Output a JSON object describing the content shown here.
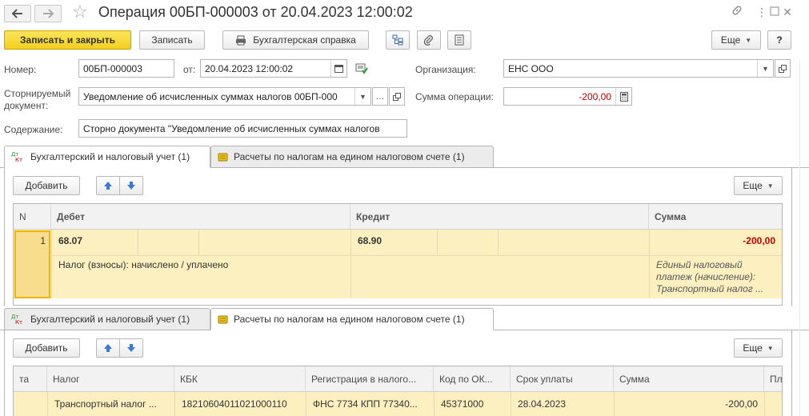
{
  "window": {
    "title": "Операция 00БП-000003 от 20.04.2023 12:00:02",
    "icons": [
      "back-arrow-icon",
      "forward-arrow-icon",
      "star-icon",
      "link-icon",
      "more-vertical-icon",
      "maximize-icon",
      "close-icon"
    ]
  },
  "toolbar": {
    "save_close": "Записать и закрыть",
    "save": "Записать",
    "report": "Бухгалтерская справка",
    "more": "Еще",
    "help": "?"
  },
  "form": {
    "number_label": "Номер:",
    "number_value": "00БП-000003",
    "date_label": "от:",
    "date_value": "20.04.2023 12:00:02",
    "org_label": "Организация:",
    "org_value": "ЕНС ООО",
    "reversed_label_1": "Сторнируемый",
    "reversed_label_2": "документ:",
    "reversed_value": "Уведомление об исчисленных суммах налогов 00БП-000",
    "amount_label": "Сумма операции:",
    "amount_value": "-200,00",
    "content_label": "Содержание:",
    "content_value": "Сторно документа \"Уведомление об исчисленных суммах налогов"
  },
  "tabs": {
    "tab1": "Бухгалтерский и налоговый учет (1)",
    "tab2": "Расчеты по налогам на едином налоговом счете (1)"
  },
  "section1": {
    "add": "Добавить",
    "more": "Еще",
    "columns": [
      "N",
      "Дебет",
      "Кредит",
      "Сумма"
    ],
    "row": {
      "n": "1",
      "debit": "68.07",
      "credit": "68.90",
      "amount": "-200,00",
      "content": "Налог (взносы): начислено / уплачено",
      "amount_desc_1": "Единый налоговый",
      "amount_desc_2": "платеж (начисление):",
      "amount_desc_3": "Транспортный налог ..."
    }
  },
  "section2": {
    "add": "Добавить",
    "more": "Еще",
    "columns": [
      "та",
      "Налог",
      "КБК",
      "Регистрация в налого...",
      "Код по ОК...",
      "Срок уплаты",
      "Сумма",
      "Пл"
    ],
    "row": {
      "tax": "Транспортный налог ...",
      "kbk": "18210604011021000110",
      "registration": "ФНС 7734 КПП 77340...",
      "oktmo": "45371000",
      "due_date": "28.04.2023",
      "amount": "-200,00"
    }
  },
  "colors": {
    "primary_button": "#f3cf1d",
    "selected_row": "#fcf0c1",
    "negative_amount": "#c00000"
  }
}
